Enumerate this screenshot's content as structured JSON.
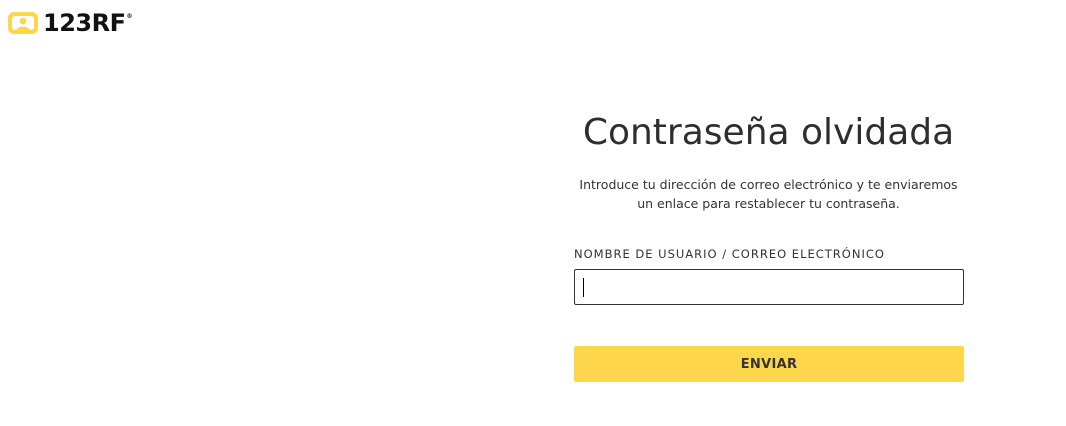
{
  "header": {
    "logo_text": "123RF",
    "logo_tm": "®",
    "logo_icon": "camera-person-icon",
    "brand_color": "#fdd64c"
  },
  "form": {
    "title": "Contraseña olvidada",
    "description_line1": "Introduce tu dirección de correo electrónico y te enviaremos",
    "description_line2": "un enlace para restablecer tu contraseña.",
    "field_label": "NOMBRE DE USUARIO / CORREO ELECTRÓNICO",
    "field_value": "",
    "field_placeholder": "",
    "submit_label": "ENVIAR"
  }
}
